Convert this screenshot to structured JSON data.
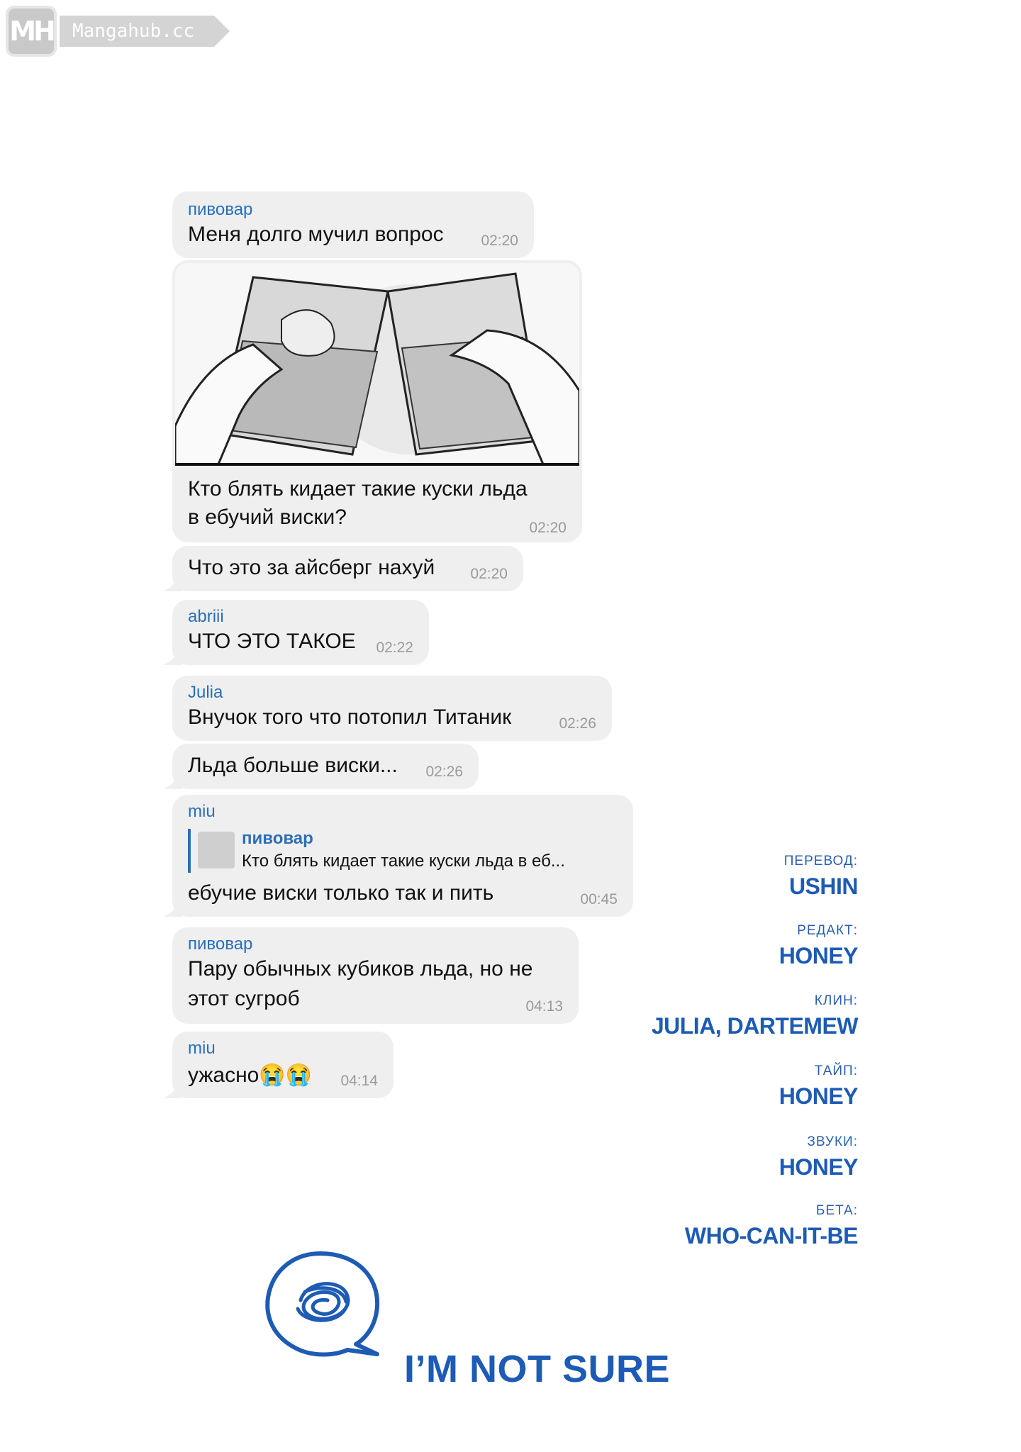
{
  "watermark": {
    "logo": "MH",
    "site": "Mangahub.cc"
  },
  "messages": [
    {
      "sender": "пивовар",
      "text": "Меня долго мучил вопрос",
      "time": "02:20"
    },
    {
      "text_line1": "Кто блять кидает такие куски льда",
      "text_line2": "в ебучий виски?",
      "time": "02:20"
    },
    {
      "text": "Что это за айсберг нахуй",
      "time": "02:20"
    },
    {
      "sender": "abriii",
      "text": "ЧТО ЭТО ТАКОЕ",
      "time": "02:22"
    },
    {
      "sender": "Julia",
      "text": "Внучок того что потопил Титаник",
      "time": "02:26"
    },
    {
      "text": "Льда больше виски...",
      "time": "02:26"
    },
    {
      "sender": "miu",
      "reply_name": "пивовар",
      "reply_text": "Кто блять кидает такие куски льда в еб...",
      "text": "ебучие виски только так и пить",
      "time": "00:45"
    },
    {
      "sender": "пивовар",
      "text_line1": "Пару обычных кубиков льда, но не",
      "text_line2": "этот сугроб",
      "time": "04:13"
    },
    {
      "sender": "miu",
      "text": "ужасно😭😭",
      "time": "04:14"
    }
  ],
  "credits": [
    {
      "label": "ПЕРЕВОД:",
      "value": "USHIN"
    },
    {
      "label": "РЕДАКТ:",
      "value": "HONEY"
    },
    {
      "label": "КЛИН:",
      "value": "JULIA, DARTEMEW"
    },
    {
      "label": "ТАЙП:",
      "value": "HONEY"
    },
    {
      "label": "ЗВУКИ:",
      "value": "HONEY"
    },
    {
      "label": "БЕТА:",
      "value": "WHO-CAN-IT-BE"
    }
  ],
  "footer": {
    "title": "I’M NOT SURE",
    "logo_icon": "scribble-speech-bubble-icon"
  },
  "colors": {
    "accent": "#1d5bb4",
    "bubble": "#efefef",
    "sender": "#2a6fb8"
  }
}
